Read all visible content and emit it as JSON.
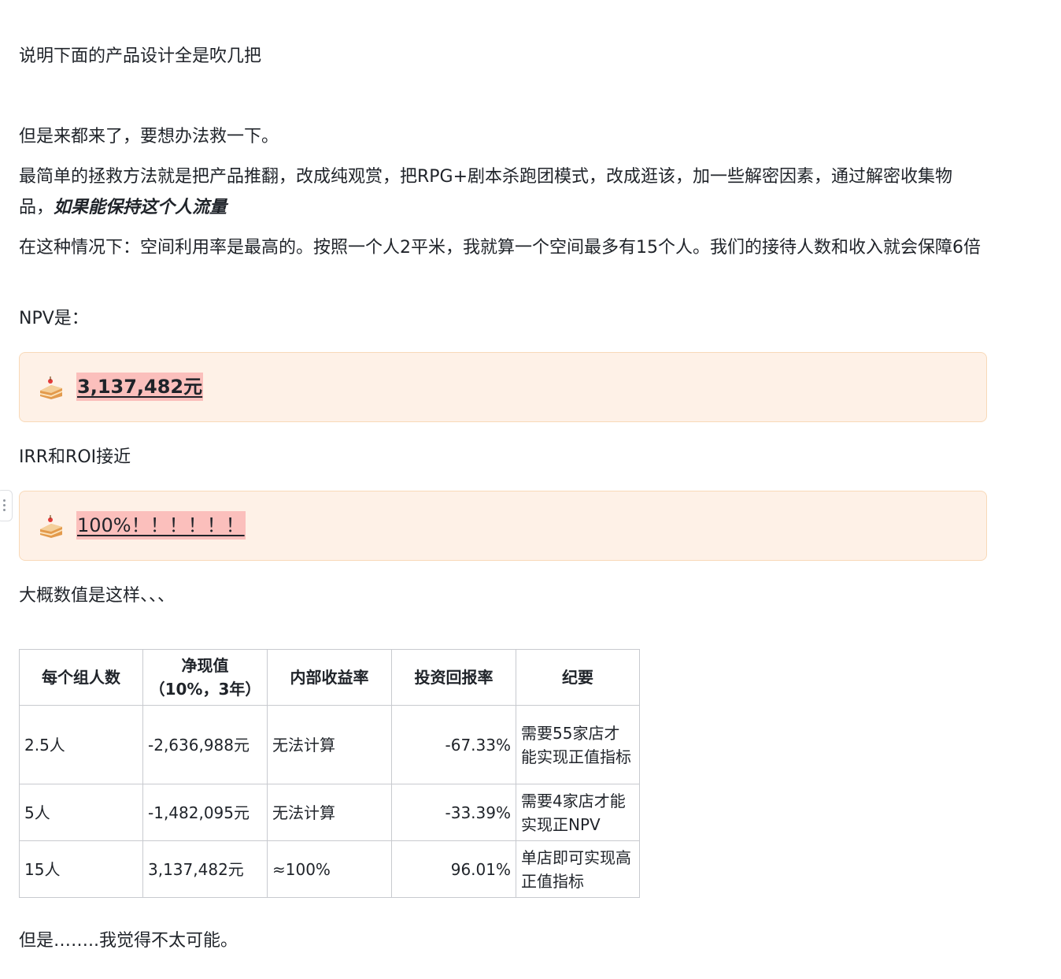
{
  "paragraphs": {
    "p1": "说明下面的产品设计全是吹几把",
    "p2": "但是来都来了，要想办法救一下。",
    "p3_text": "最简单的拯救方法就是把产品推翻，改成纯观赏，把RPG+剧本杀跑团模式，改成逛该，加一些解密因素，通过解密收集物品，",
    "p3_emphasis": "如果能保持这个人流量",
    "p4": "在这种情况下：空间利用率是最高的。按照一个人2平米，我就算一个空间最多有15个人。我们的接待人数和收入就会保障6倍",
    "p5": "NPV是：",
    "p6": "IRR和ROI接近",
    "p7": "大概数值是这样、、、",
    "p8": "但是……..我觉得不太可能。"
  },
  "callouts": {
    "npv": {
      "icon": "cake-icon",
      "value": "3,137,482元"
    },
    "irr": {
      "icon": "cake-icon",
      "value": "100%！！！！！！"
    }
  },
  "table": {
    "headers": [
      "每个组人数",
      "净现值\n（10%，3年）",
      "内部收益率",
      "投资回报率",
      "纪要"
    ],
    "rows": [
      [
        "2.5人",
        "-2,636,988元",
        "无法计算",
        "-67.33%",
        "需要55家店才能实现正值指标"
      ],
      [
        "5人",
        "-1,482,095元",
        "无法计算",
        "-33.39%",
        "需要4家店才能实现正NPV"
      ],
      [
        "15人",
        "3,137,482元",
        "≈100%",
        "96.01%",
        "单店即可实现高正值指标"
      ]
    ]
  },
  "colors": {
    "text": "#1f2329",
    "callout_bg": "#fef1e7",
    "callout_border": "#f8d9b8",
    "highlight": "#fbbfbc",
    "table_border": "#c8cacf"
  }
}
